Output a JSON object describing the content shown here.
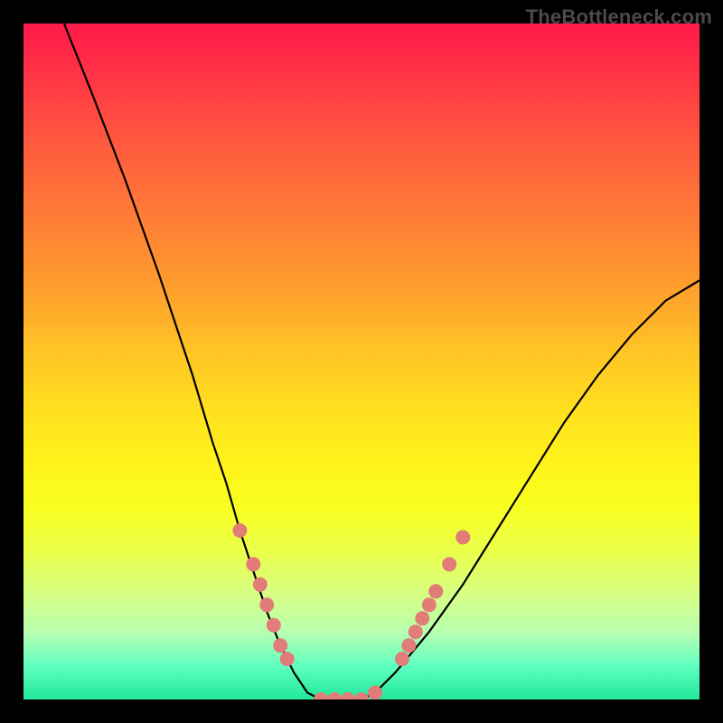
{
  "watermark": "TheBottleneck.com",
  "chart_data": {
    "type": "line",
    "title": "",
    "xlabel": "",
    "ylabel": "",
    "xlim": [
      0,
      100
    ],
    "ylim": [
      0,
      100
    ],
    "series": [
      {
        "name": "bottleneck-curve",
        "x": [
          6,
          10,
          15,
          20,
          25,
          28,
          30,
          32,
          34,
          36,
          38,
          40,
          42,
          44,
          46,
          48,
          50,
          52,
          55,
          60,
          65,
          70,
          75,
          80,
          85,
          90,
          95,
          100
        ],
        "y": [
          100,
          90,
          77,
          63,
          48,
          38,
          32,
          25,
          19,
          13,
          8,
          4,
          1,
          0,
          0,
          0,
          0,
          1,
          4,
          10,
          17,
          25,
          33,
          41,
          48,
          54,
          59,
          62
        ]
      }
    ],
    "markers": {
      "name": "highlighted-points",
      "color": "#e27c78",
      "points": [
        {
          "x": 32,
          "y": 25
        },
        {
          "x": 34,
          "y": 20
        },
        {
          "x": 35,
          "y": 17
        },
        {
          "x": 36,
          "y": 14
        },
        {
          "x": 37,
          "y": 11
        },
        {
          "x": 38,
          "y": 8
        },
        {
          "x": 39,
          "y": 6
        },
        {
          "x": 44,
          "y": 0
        },
        {
          "x": 46,
          "y": 0
        },
        {
          "x": 48,
          "y": 0
        },
        {
          "x": 50,
          "y": 0
        },
        {
          "x": 52,
          "y": 1
        },
        {
          "x": 56,
          "y": 6
        },
        {
          "x": 57,
          "y": 8
        },
        {
          "x": 58,
          "y": 10
        },
        {
          "x": 59,
          "y": 12
        },
        {
          "x": 60,
          "y": 14
        },
        {
          "x": 61,
          "y": 16
        },
        {
          "x": 63,
          "y": 20
        },
        {
          "x": 65,
          "y": 24
        }
      ]
    },
    "background_gradient": {
      "top": "#ff1a4a",
      "middle": "#fff51a",
      "bottom": "#20e89a"
    }
  }
}
